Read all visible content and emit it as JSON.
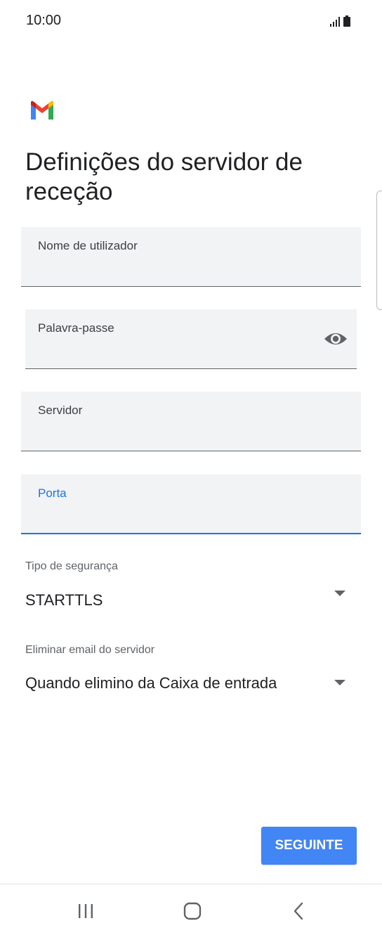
{
  "status_bar": {
    "time": "10:00",
    "signal_icon": "signal-bars-icon",
    "battery_icon": "battery-icon"
  },
  "app": {
    "logo_icon": "gmail-logo-icon",
    "colors": {
      "accent": "#1a73e8",
      "button": "#4285f4",
      "field_bg": "#f1f3f4"
    }
  },
  "page": {
    "title": "Definições do servidor de receção"
  },
  "form": {
    "username": {
      "label": "Nome de utilizador",
      "value": ""
    },
    "password": {
      "label": "Palavra-passe",
      "value": "",
      "toggle_icon": "eye-icon"
    },
    "server": {
      "label": "Servidor",
      "value": ""
    },
    "port": {
      "label": "Porta",
      "value": ""
    },
    "security_type": {
      "label": "Tipo de segurança",
      "value": "STARTTLS"
    },
    "delete_email": {
      "label": "Eliminar email do servidor",
      "value": "Quando elimino da Caixa de entrada"
    }
  },
  "actions": {
    "next_label": "SEGUINTE"
  },
  "nav_bar": {
    "recents_icon": "recent-apps-icon",
    "home_icon": "home-icon",
    "back_icon": "back-icon"
  }
}
